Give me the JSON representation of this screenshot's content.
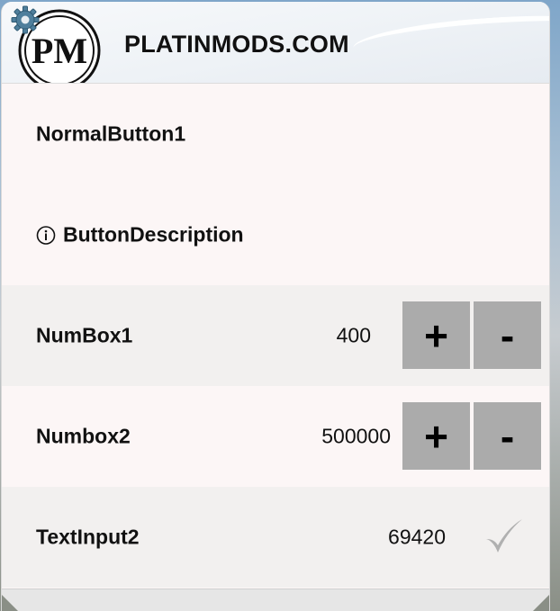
{
  "header": {
    "title": "PLATINMODS.COM",
    "logo_text": "PM",
    "logo_icon": "platinmods-logo",
    "settings_icon": "gear-icon"
  },
  "items": {
    "normal_button": {
      "label": "NormalButton1"
    },
    "description": {
      "icon": "info-icon",
      "label": "ButtonDescription"
    },
    "numbox1": {
      "label": "NumBox1",
      "value": "400",
      "plus": "+",
      "minus": "-"
    },
    "numbox2": {
      "label": "Numbox2",
      "value": "500000",
      "plus": "+",
      "minus": "-"
    },
    "text_input": {
      "label": "TextInput2",
      "value": "69420",
      "confirm_icon": "checkmark-icon"
    }
  },
  "colors": {
    "row_light": "#fcf6f6",
    "row_grey": "#f2f0ef",
    "button_bg": "#ababab",
    "text": "#111111"
  }
}
